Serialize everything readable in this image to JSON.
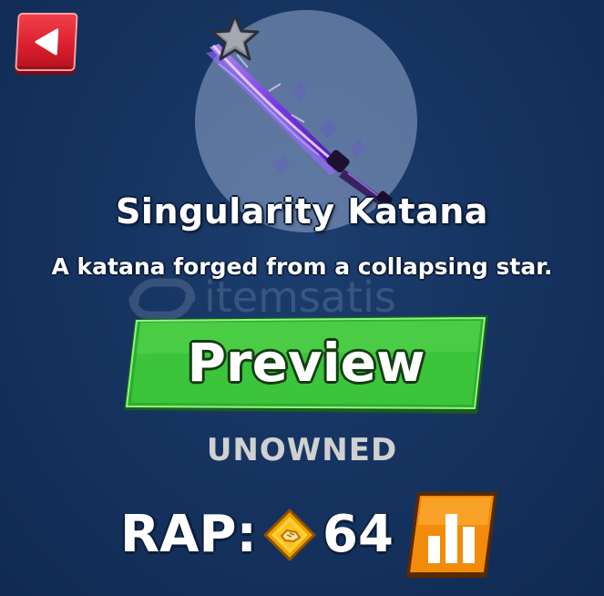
{
  "item": {
    "name": "Singularity Katana",
    "description": "A katana forged from a collapsing star.",
    "rarity_icon": "star-icon"
  },
  "watermark": {
    "text": "itemsatis"
  },
  "actions": {
    "back_icon": "back-arrow-icon",
    "preview_label": "Preview"
  },
  "status": {
    "ownership": "UNOWNED"
  },
  "rap": {
    "label": "RAP:",
    "value": "64",
    "currency_icon": "coin-icon",
    "stats_icon": "bar-chart-icon"
  },
  "colors": {
    "background": "#163461",
    "preview_green": "#3cc43a",
    "back_red": "#e02a36",
    "stats_orange": "#f28a0a"
  }
}
